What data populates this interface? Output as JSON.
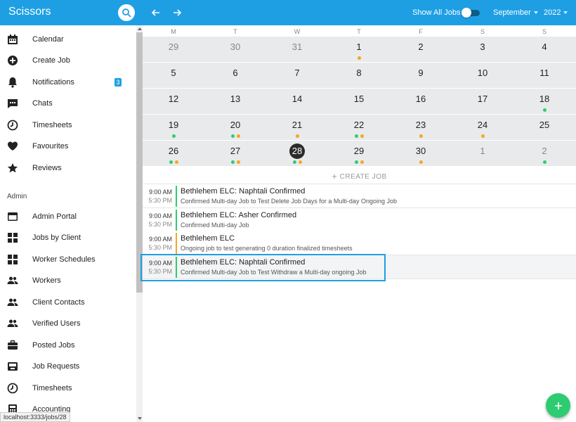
{
  "app": {
    "title": "Scissors"
  },
  "header": {
    "show_all_label": "Show All Jobs",
    "show_all_on": true,
    "month": "September",
    "year": "2022"
  },
  "sidebar": {
    "items": [
      {
        "label": "Calendar",
        "icon": "calendar-icon"
      },
      {
        "label": "Create Job",
        "icon": "plus-circle-icon"
      },
      {
        "label": "Notifications",
        "icon": "bell-icon",
        "badge": "3"
      },
      {
        "label": "Chats",
        "icon": "chat-icon"
      },
      {
        "label": "Timesheets",
        "icon": "clock-icon"
      },
      {
        "label": "Favourites",
        "icon": "heart-icon"
      },
      {
        "label": "Reviews",
        "icon": "star-icon"
      }
    ],
    "admin_title": "Admin",
    "admin_items": [
      {
        "label": "Admin Portal",
        "icon": "window-icon"
      },
      {
        "label": "Jobs by Client",
        "icon": "grid-icon"
      },
      {
        "label": "Worker Schedules",
        "icon": "grid-icon"
      },
      {
        "label": "Workers",
        "icon": "people-icon"
      },
      {
        "label": "Client Contacts",
        "icon": "people-icon"
      },
      {
        "label": "Verified Users",
        "icon": "people-icon"
      },
      {
        "label": "Posted Jobs",
        "icon": "briefcase-icon"
      },
      {
        "label": "Job Requests",
        "icon": "inbox-icon"
      },
      {
        "label": "Timesheets",
        "icon": "clock-icon"
      },
      {
        "label": "Accounting",
        "icon": "calculator-icon"
      }
    ]
  },
  "calendar": {
    "weekdays": [
      "M",
      "T",
      "W",
      "T",
      "F",
      "S",
      "S"
    ],
    "weeks": [
      [
        {
          "d": "29",
          "muted": true,
          "dots": []
        },
        {
          "d": "30",
          "muted": true,
          "dots": []
        },
        {
          "d": "31",
          "muted": true,
          "dots": []
        },
        {
          "d": "1",
          "dots": [
            "o"
          ]
        },
        {
          "d": "2",
          "dots": []
        },
        {
          "d": "3",
          "dots": []
        },
        {
          "d": "4",
          "dots": []
        }
      ],
      [
        {
          "d": "5",
          "dots": []
        },
        {
          "d": "6",
          "dots": []
        },
        {
          "d": "7",
          "dots": []
        },
        {
          "d": "8",
          "dots": []
        },
        {
          "d": "9",
          "dots": []
        },
        {
          "d": "10",
          "dots": []
        },
        {
          "d": "11",
          "dots": []
        }
      ],
      [
        {
          "d": "12",
          "dots": []
        },
        {
          "d": "13",
          "dots": []
        },
        {
          "d": "14",
          "dots": []
        },
        {
          "d": "15",
          "dots": []
        },
        {
          "d": "16",
          "dots": []
        },
        {
          "d": "17",
          "dots": []
        },
        {
          "d": "18",
          "dots": [
            "g"
          ]
        }
      ],
      [
        {
          "d": "19",
          "dots": [
            "g"
          ]
        },
        {
          "d": "20",
          "dots": [
            "g",
            "o"
          ]
        },
        {
          "d": "21",
          "dots": [
            "o"
          ]
        },
        {
          "d": "22",
          "dots": [
            "g",
            "o"
          ]
        },
        {
          "d": "23",
          "dots": [
            "o"
          ]
        },
        {
          "d": "24",
          "dots": [
            "o"
          ]
        },
        {
          "d": "25",
          "dots": []
        }
      ],
      [
        {
          "d": "26",
          "dots": [
            "g",
            "o"
          ]
        },
        {
          "d": "27",
          "dots": [
            "g",
            "o"
          ]
        },
        {
          "d": "28",
          "today": true,
          "dots": [
            "g",
            "o"
          ]
        },
        {
          "d": "29",
          "dots": [
            "g",
            "o"
          ]
        },
        {
          "d": "30",
          "dots": [
            "o"
          ]
        },
        {
          "d": "1",
          "muted": true,
          "dots": []
        },
        {
          "d": "2",
          "muted": true,
          "dots": [
            "g"
          ]
        }
      ]
    ],
    "create_job_label": "CREATE JOB"
  },
  "events": [
    {
      "start": "9:00 AM",
      "end": "5:30 PM",
      "title": "Bethlehem ELC: Naphtali Confirmed",
      "subtitle": "Confirmed Multi-day Job to Test Delete Job Days for a Multi-day Ongoing Job",
      "color": "g"
    },
    {
      "start": "9:00 AM",
      "end": "5:30 PM",
      "title": "Bethlehem ELC: Asher Confirmed",
      "subtitle": "Confirmed Multi-day Job",
      "color": "g"
    },
    {
      "start": "9:00 AM",
      "end": "5:30 PM",
      "title": "Bethlehem ELC",
      "subtitle": "Ongoing job to test generating 0 duration finalized timesheets",
      "color": "o"
    },
    {
      "start": "9:00 AM",
      "end": "5:30 PM",
      "title": "Bethlehem ELC: Naphtali Confirmed",
      "subtitle": "Confirmed Multi-day Job to Test Withdraw a Multi-day ongoing Job",
      "color": "g",
      "selected": true
    }
  ],
  "status_url": "localhost:3333/jobs/28",
  "colors": {
    "primary": "#1e9fe4",
    "green": "#2ecc71",
    "orange": "#f5a623"
  }
}
